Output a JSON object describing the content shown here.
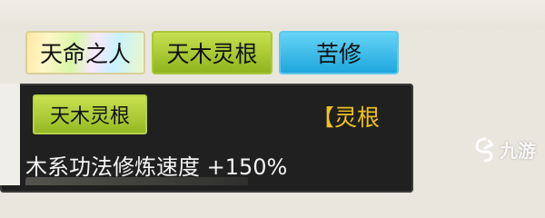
{
  "traits": {
    "items": [
      {
        "label": "天命之人"
      },
      {
        "label": "天木灵根"
      },
      {
        "label": "苦修"
      }
    ]
  },
  "tooltip": {
    "badge_label": "天木灵根",
    "category_label": "【灵根",
    "effect_text": "木系功法修炼速度 +150%"
  },
  "watermark": {
    "text": "九游",
    "icon": "jiuyou-logo-icon"
  }
}
